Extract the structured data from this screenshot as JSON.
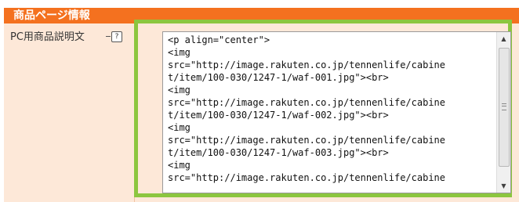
{
  "section": {
    "title": "商品ページ情報"
  },
  "field": {
    "label": "PC用商品説明文",
    "help_icon": "question-icon",
    "value_lines": [
      "<p align=\"center\">",
      "<img",
      "src=\"http://image.rakuten.co.jp/tennenlife/cabine",
      "t/item/100-030/1247-1/waf-001.jpg\"><br>",
      "<img",
      "src=\"http://image.rakuten.co.jp/tennenlife/cabine",
      "t/item/100-030/1247-1/waf-002.jpg\"><br>",
      "<img",
      "src=\"http://image.rakuten.co.jp/tennenlife/cabine",
      "t/item/100-030/1247-1/waf-003.jpg\"><br>",
      "<img",
      "src=\"http://image.rakuten.co.jp/tennenlife/cabine"
    ]
  },
  "scrollbar": {
    "up_arrow": "▲",
    "down_arrow": "▼"
  },
  "colors": {
    "header": "#f4711f",
    "label_bg": "#fde8d8",
    "highlight_border": "#8cc63f"
  }
}
